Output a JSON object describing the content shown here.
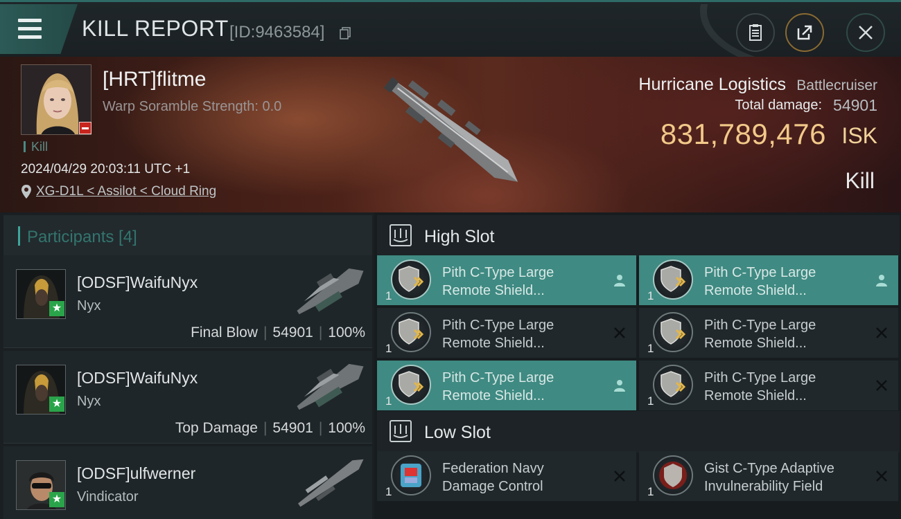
{
  "header": {
    "title": "KILL REPORT",
    "report_id": "[ID:9463584]"
  },
  "victim": {
    "pilot_name": "[HRT]flitme",
    "warp_scramble": "Warp Soramble Strength: 0.0",
    "kill_tag": "Kill",
    "datetime": "2024/04/29 20:03:11 UTC +1",
    "location": "XG-D1L < Assilot < Cloud Ring",
    "ship_name": "Hurricane Logistics",
    "ship_class": "Battlecruiser",
    "total_damage_label": "Total damage:",
    "total_damage": "54901",
    "isk_value": "831,789,476",
    "isk_unit": "ISK",
    "outcome": "Kill"
  },
  "participants": {
    "label": "Participants [4]",
    "rows": [
      {
        "name": "[ODSF]WaifuNyx",
        "ship": "Nyx",
        "role": "Final Blow",
        "damage": "54901",
        "percent": "100%"
      },
      {
        "name": "[ODSF]WaifuNyx",
        "ship": "Nyx",
        "role": "Top Damage",
        "damage": "54901",
        "percent": "100%"
      },
      {
        "name": "[ODSF]ulfwerner",
        "ship": "Vindicator"
      }
    ]
  },
  "slots": {
    "high_label": "High Slot",
    "low_label": "Low Slot",
    "high": [
      {
        "qty": "1",
        "line1": "Pith C-Type Large",
        "line2": "Remote Shield...",
        "state": "person"
      },
      {
        "qty": "1",
        "line1": "Pith C-Type Large",
        "line2": "Remote Shield...",
        "state": "person"
      },
      {
        "qty": "1",
        "line1": "Pith C-Type Large",
        "line2": "Remote Shield...",
        "state": "x"
      },
      {
        "qty": "1",
        "line1": "Pith C-Type Large",
        "line2": "Remote Shield...",
        "state": "x"
      },
      {
        "qty": "1",
        "line1": "Pith C-Type Large",
        "line2": "Remote Shield...",
        "state": "person"
      },
      {
        "qty": "1",
        "line1": "Pith C-Type Large",
        "line2": "Remote Shield...",
        "state": "x"
      }
    ],
    "low": [
      {
        "qty": "1",
        "line1": "Federation Navy",
        "line2": "Damage Control",
        "state": "x"
      },
      {
        "qty": "1",
        "line1": "Gist C-Type Adaptive",
        "line2": "Invulnerability Field",
        "state": "x"
      }
    ]
  }
}
